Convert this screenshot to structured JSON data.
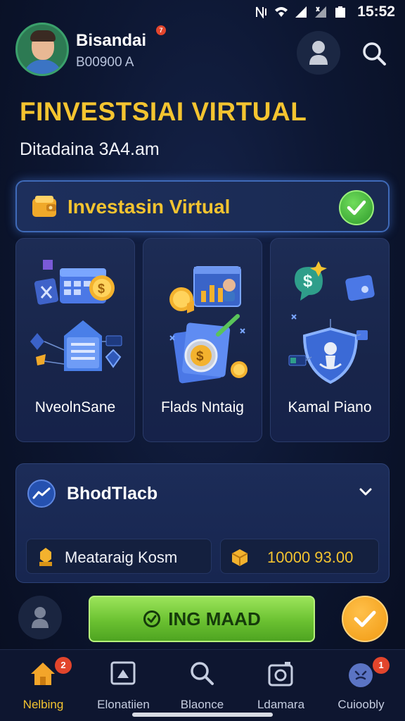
{
  "status_bar": {
    "time": "15:52"
  },
  "header": {
    "user_name": "Bisandai",
    "user_sub": "B00900 A",
    "notification_count": "7"
  },
  "page": {
    "title": "FINVESTSIAI VIRTUAL",
    "subtitle": "Ditadaina 3A4.am"
  },
  "banner": {
    "label": "Investasin Virtual"
  },
  "cards": [
    {
      "label": "NveolnSane",
      "icon": "calendar-coin-icon"
    },
    {
      "label": "Flads Nntaig",
      "icon": "coin-document-icon"
    },
    {
      "label": "Kamal Piano",
      "icon": "shield-icon"
    }
  ],
  "dashboard": {
    "title": "BhodTlacb",
    "stat_label": "Meataraig Kosm",
    "stat_value": "10000 93.00"
  },
  "actions": {
    "primary_label": "ING MAAD"
  },
  "bottom_nav": [
    {
      "label": "Nelbing",
      "icon": "home-icon",
      "badge": "2",
      "active": true
    },
    {
      "label": "Elonatiien",
      "icon": "screen-icon"
    },
    {
      "label": "Blaonce",
      "icon": "search-icon"
    },
    {
      "label": "Ldamara",
      "icon": "camera-icon"
    },
    {
      "label": "Cuioobly",
      "icon": "profile-icon",
      "badge": "1"
    }
  ],
  "colors": {
    "accent_gold": "#f4c430",
    "success_green": "#6bc131",
    "badge_red": "#e2452c",
    "background": "#0d1733"
  }
}
